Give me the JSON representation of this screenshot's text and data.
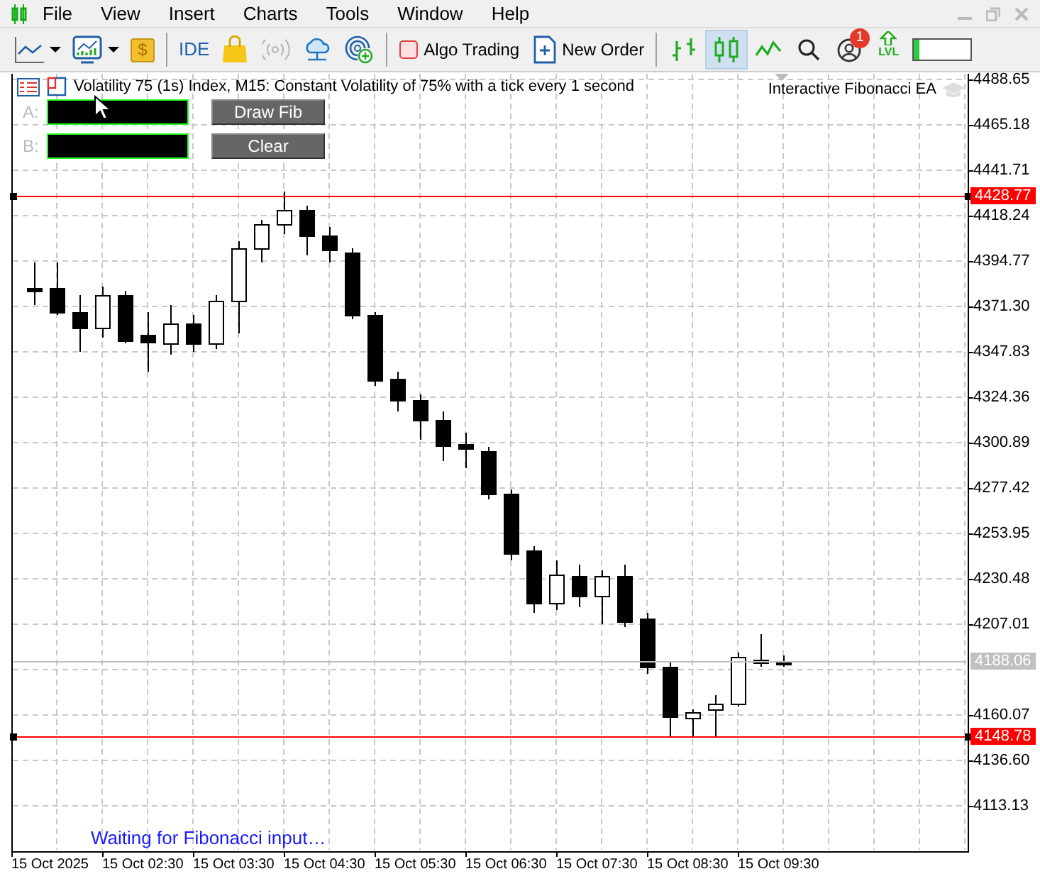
{
  "menu": {
    "items": [
      "File",
      "View",
      "Insert",
      "Charts",
      "Tools",
      "Window",
      "Help"
    ]
  },
  "toolbar": {
    "tools": [
      {
        "kind": "line-chart",
        "caret": true,
        "disabled": false
      },
      {
        "kind": "indicator-chart",
        "caret": true,
        "disabled": false
      },
      {
        "kind": "dollar",
        "label": "$",
        "caret": false,
        "disabled": false
      },
      {
        "kind": "ide",
        "label": "IDE",
        "caret": false,
        "disabled": false
      },
      {
        "kind": "bag",
        "caret": false,
        "disabled": false
      },
      {
        "kind": "signal",
        "caret": false,
        "disabled": true
      },
      {
        "kind": "cloud",
        "caret": false,
        "disabled": false
      },
      {
        "kind": "radar",
        "caret": false,
        "disabled": false
      }
    ],
    "algo_trading": {
      "label": "Algo Trading",
      "on": false
    },
    "new_order": {
      "label": "New Order"
    },
    "chart_types": [
      {
        "kind": "bars",
        "selected": false
      },
      {
        "kind": "candles",
        "selected": true
      },
      {
        "kind": "line",
        "selected": false
      }
    ],
    "notifications": {
      "badge": "1"
    },
    "level_button": {
      "label": "LVL"
    },
    "meter": {
      "level": 0.12
    }
  },
  "chart": {
    "title": "Volatility 75 (1s) Index, M15:  Constant Volatility of 75% with a tick every 1 second",
    "expert": "Interactive Fibonacci EA",
    "inputs": [
      {
        "label": "A:"
      },
      {
        "label": "B:"
      }
    ],
    "buttons": [
      "Draw Fib",
      "Clear"
    ],
    "status": "Waiting for Fibonacci input…",
    "price_axis": [
      "4488.65",
      "4465.18",
      "4441.71",
      "4418.24",
      "4394.77",
      "4371.30",
      "4347.83",
      "4324.36",
      "4300.89",
      "4277.42",
      "4253.95",
      "4230.48",
      "4207.01",
      "4160.07",
      "4136.60",
      "4113.13"
    ],
    "price_markers": [
      {
        "value": "4428.77",
        "color": "#ff0000"
      },
      {
        "value": "4188.06",
        "color": "#c0c0c0"
      },
      {
        "value": "4148.78",
        "color": "#ff0000"
      }
    ],
    "time_axis": [
      "15 Oct 2025",
      "15 Oct 02:30",
      "15 Oct 03:30",
      "15 Oct 04:30",
      "15 Oct 05:30",
      "15 Oct 06:30",
      "15 Oct 07:30",
      "15 Oct 08:30",
      "15 Oct 09:30"
    ]
  }
}
